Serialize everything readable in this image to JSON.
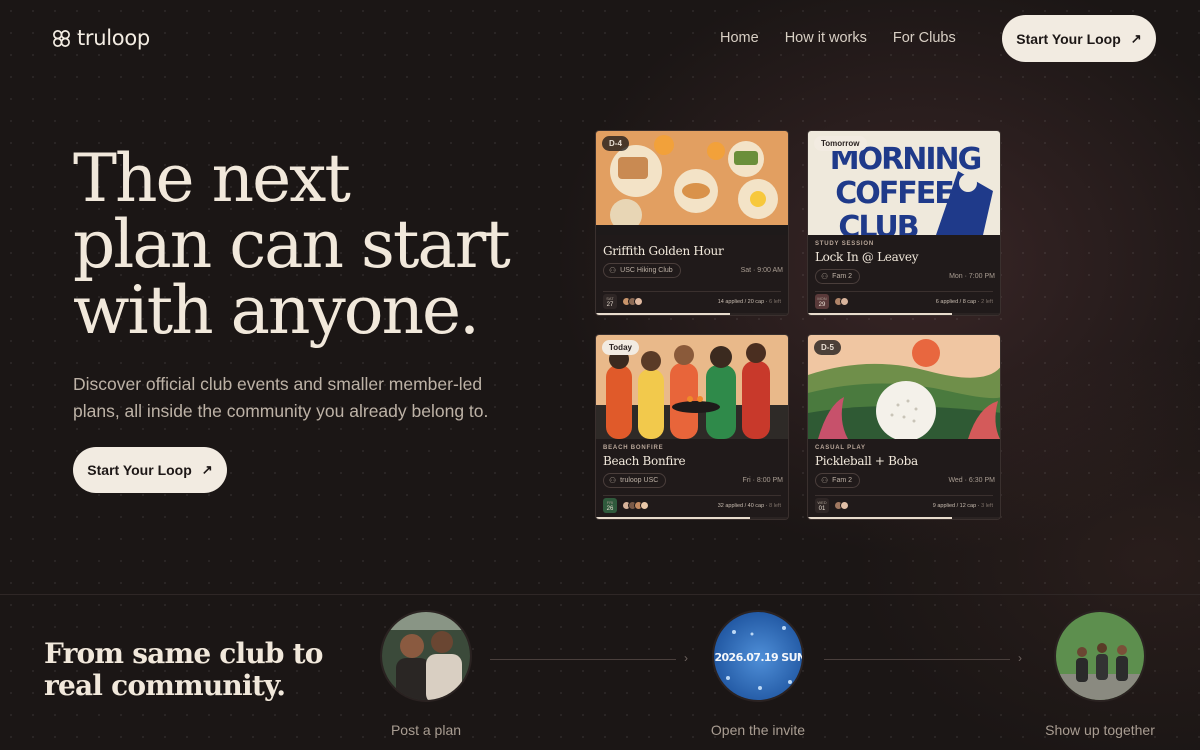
{
  "header": {
    "logo_text": "truloop",
    "nav": [
      "Home",
      "How it works",
      "For Clubs"
    ],
    "cta_label": "Start Your Loop"
  },
  "hero": {
    "title_lines": [
      "The next",
      "plan can start",
      "with anyone."
    ],
    "subtitle": "Discover official club events and smaller member-led plans, all inside the community you already belong to.",
    "cta_label": "Start Your Loop"
  },
  "cards": [
    {
      "badge": "D-4",
      "category": "",
      "title": "Griffith Golden Hour",
      "club": "USC Hiking Club",
      "when": "Sat · 9:00 AM",
      "date_day": "SAT",
      "date_num": "27",
      "applied": "14 applied / 20 cap",
      "left": "6 left",
      "fill": 0.7
    },
    {
      "badge": "Tomorrow",
      "category": "STUDY SESSION",
      "title": "Lock In @ Leavey",
      "club": "Fam 2",
      "when": "Mon · 7:00 PM",
      "date_day": "MON",
      "date_num": "29",
      "applied": "6 applied / 8 cap",
      "left": "2 left",
      "fill": 0.75
    },
    {
      "badge": "Today",
      "category": "BEACH BONFIRE",
      "title": "Beach Bonfire",
      "club": "truloop USC",
      "when": "Fri · 8:00 PM",
      "date_day": "FRI",
      "date_num": "26",
      "applied": "32 applied / 40 cap",
      "left": "8 left",
      "fill": 0.8
    },
    {
      "badge": "D-5",
      "category": "CASUAL PLAY",
      "title": "Pickleball + Boba",
      "club": "Fam 2",
      "when": "Wed · 6:30 PM",
      "date_day": "WED",
      "date_num": "01",
      "applied": "9 applied / 12 cap",
      "left": "3 left",
      "fill": 0.75
    }
  ],
  "card_art": {
    "coffee_line1": "MORNING",
    "coffee_line2": "COFFEE",
    "coffee_line3": "CLUB"
  },
  "band": {
    "title": "From same club to real community.",
    "steps": [
      "Post a plan",
      "Open the invite",
      "Show up together"
    ],
    "invite_text": "2026.07.19 SUN"
  },
  "colors": {
    "background": "#1b1615",
    "button": "#f2ebe1",
    "text": "#f1e8db"
  }
}
